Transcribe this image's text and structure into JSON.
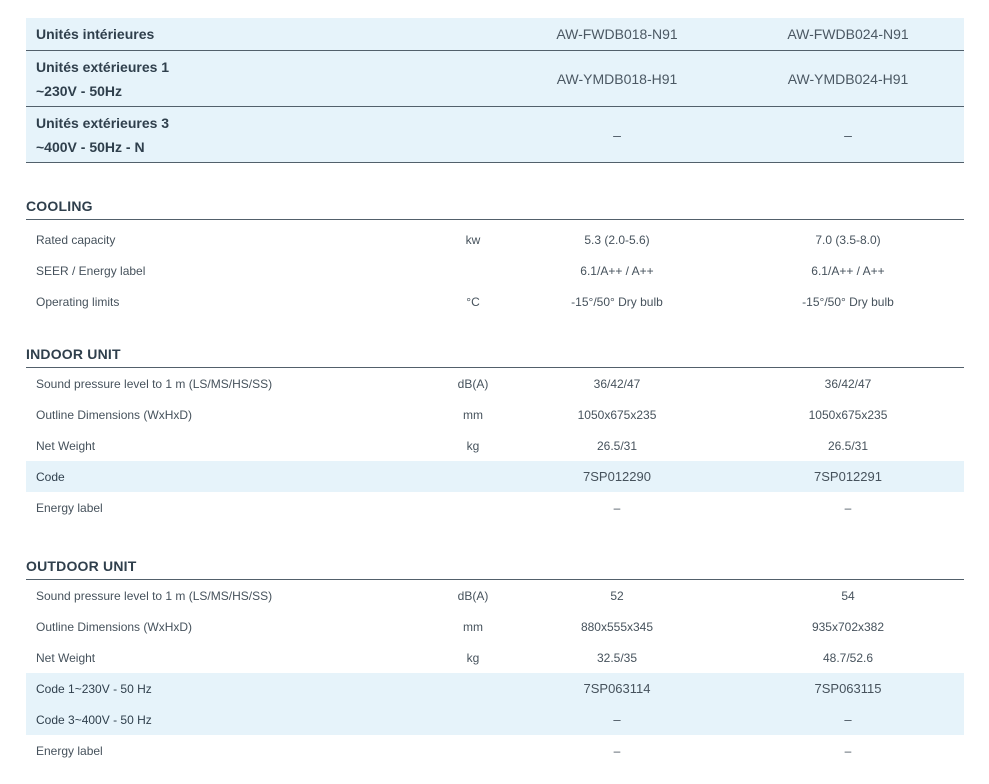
{
  "header": {
    "indoor_label": "Unités intérieures",
    "indoor_models": [
      "AW-FWDB018-N91",
      "AW-FWDB024-N91"
    ],
    "outdoor1_label_line1": "Unités extérieures 1",
    "outdoor1_label_line2": "~230V - 50Hz",
    "outdoor1_models": [
      "AW-YMDB018-H91",
      "AW-YMDB024-H91"
    ],
    "outdoor3_label_line1": "Unités extérieures 3",
    "outdoor3_label_line2": "~400V - 50Hz - N",
    "outdoor3_models": [
      "–",
      "–"
    ]
  },
  "cooling": {
    "title": "COOLING",
    "rows": [
      {
        "label": "Rated capacity",
        "unit": "kw",
        "v1": "5.3 (2.0-5.6)",
        "v2": "7.0 (3.5-8.0)"
      },
      {
        "label": "SEER / Energy label",
        "unit": "",
        "v1": "6.1/A++ / A++",
        "v2": "6.1/A++ / A++"
      },
      {
        "label": "Operating limits",
        "unit": "°C",
        "v1": "-15°/50° Dry bulb",
        "v2": "-15°/50° Dry bulb"
      }
    ]
  },
  "indoor": {
    "title": "INDOOR UNIT",
    "rows": [
      {
        "label": "Sound pressure level to 1 m (LS/MS/HS/SS)",
        "unit": "dB(A)",
        "v1": "36/42/47",
        "v2": "36/42/47"
      },
      {
        "label": "Outline Dimensions (WxHxD)",
        "unit": "mm",
        "v1": "1050x675x235",
        "v2": "1050x675x235"
      },
      {
        "label": "Net Weight",
        "unit": "kg",
        "v1": "26.5/31",
        "v2": "26.5/31"
      },
      {
        "label": "Code",
        "unit": "",
        "v1": "7SP012290",
        "v2": "7SP012291"
      },
      {
        "label": "Energy label",
        "unit": "",
        "v1": "–",
        "v2": "–"
      }
    ]
  },
  "outdoor": {
    "title": "OUTDOOR UNIT",
    "rows": [
      {
        "label": "Sound pressure level to 1 m (LS/MS/HS/SS)",
        "unit": "dB(A)",
        "v1": "52",
        "v2": "54"
      },
      {
        "label": "Outline Dimensions (WxHxD)",
        "unit": "mm",
        "v1": "880x555x345",
        "v2": "935x702x382"
      },
      {
        "label": "Net Weight",
        "unit": "kg",
        "v1": "32.5/35",
        "v2": "48.7/52.6"
      },
      {
        "label": "Code 1~230V - 50 Hz",
        "unit": "",
        "v1": "7SP063114",
        "v2": "7SP063115"
      },
      {
        "label": "Code 3~400V - 50 Hz",
        "unit": "",
        "v1": "–",
        "v2": "–"
      },
      {
        "label": "Energy label",
        "unit": "",
        "v1": "–",
        "v2": "–"
      }
    ]
  }
}
